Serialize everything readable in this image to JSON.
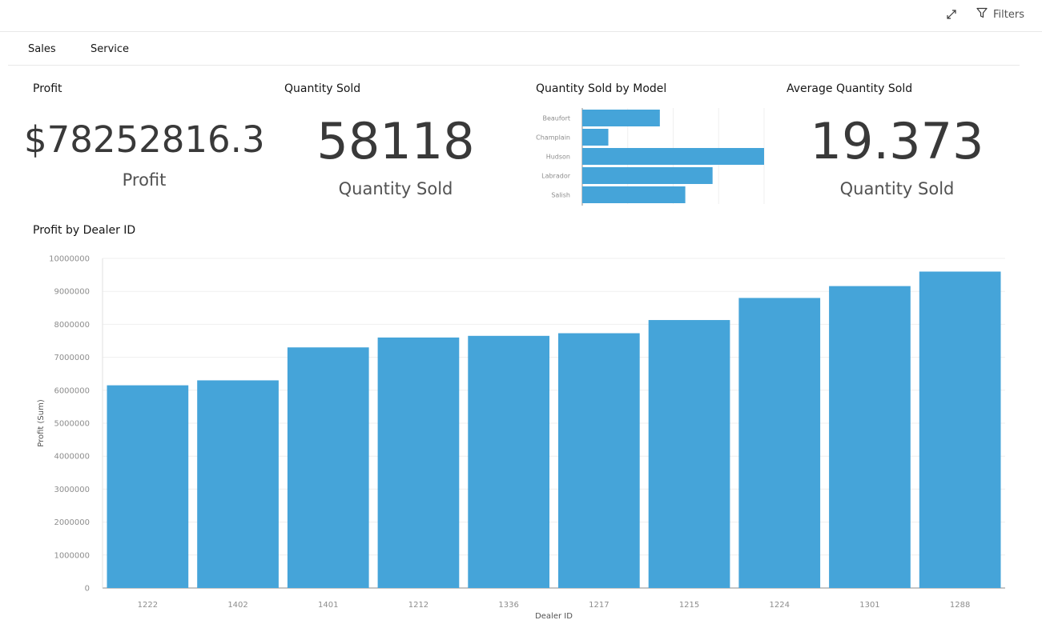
{
  "header": {
    "filters_label": "Filters",
    "expand_icon": "expand-arrows-icon",
    "filter_icon": "funnel-icon"
  },
  "tabs": [
    {
      "label": "Sales"
    },
    {
      "label": "Service"
    }
  ],
  "tiles": {
    "profit": {
      "title": "Profit",
      "value": "$78252816.3",
      "label": "Profit"
    },
    "quantity": {
      "title": "Quantity Sold",
      "value": "58118",
      "label": "Quantity Sold"
    },
    "model_chart_title": "Quantity Sold by Model",
    "average": {
      "title": "Average Quantity Sold",
      "value": "19.373",
      "label": "Quantity Sold"
    },
    "dealer_chart_title": "Profit by Dealer ID"
  },
  "colors": {
    "bar": "#45a4d9",
    "axis_text": "#8d8d8d",
    "grid": "#efefef"
  },
  "chart_data": [
    {
      "type": "bar",
      "orientation": "horizontal",
      "title": "Quantity Sold by Model",
      "categories": [
        "Beaufort",
        "Champlain",
        "Hudson",
        "Labrador",
        "Salish"
      ],
      "values": [
        12800,
        4300,
        30000,
        21500,
        17000
      ],
      "xlim": [
        0,
        30000
      ],
      "grid": true
    },
    {
      "type": "bar",
      "title": "Profit by Dealer ID",
      "xlabel": "Dealer ID",
      "ylabel": "Profit (Sum)",
      "categories": [
        "1222",
        "1402",
        "1401",
        "1212",
        "1336",
        "1217",
        "1215",
        "1224",
        "1301",
        "1288"
      ],
      "values": [
        6150000,
        6300000,
        7300000,
        7600000,
        7650000,
        7730000,
        8130000,
        8800000,
        9160000,
        9600000
      ],
      "ylim": [
        0,
        10000000
      ],
      "yticks": [
        "0",
        "1000000",
        "2000000",
        "3000000",
        "4000000",
        "5000000",
        "6000000",
        "7000000",
        "8000000",
        "9000000",
        "10000000"
      ],
      "grid": true
    }
  ]
}
